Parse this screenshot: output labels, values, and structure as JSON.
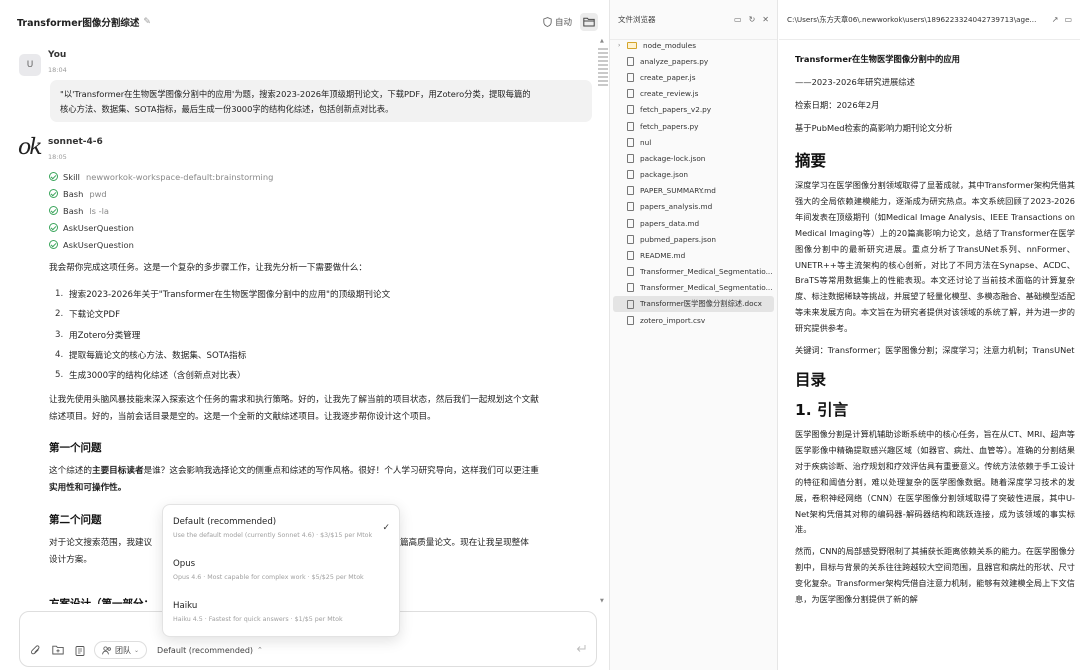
{
  "chat": {
    "title": "Transformer图像分割综述",
    "auto_label": "自动",
    "user": {
      "avatar": "U",
      "name": "You",
      "time": "18:04",
      "message_line1": "\"以'Transformer在生物医学图像分割中的应用'为题，搜索2023-2026年顶级期刊论文，下载PDF，用Zotero分类，提取每篇的",
      "message_line2": "核心方法、数据集、SOTA指标，最后生成一份3000字的结构化综述，包括创新点对比表。"
    },
    "assistant": {
      "logo": "ok",
      "name": "sonnet-4-6",
      "time": "18:05",
      "tools": [
        {
          "name": "Skill",
          "arg": "newworkok-workspace-default:brainstorming"
        },
        {
          "name": "Bash",
          "arg": "pwd"
        },
        {
          "name": "Bash",
          "arg": "ls -la"
        },
        {
          "name": "AskUserQuestion",
          "arg": ""
        },
        {
          "name": "AskUserQuestion",
          "arg": ""
        }
      ],
      "intro": "我会帮你完成这项任务。这是一个复杂的多步骤工作，让我先分析一下需要做什么：",
      "steps": [
        "搜索2023-2026年关于\"Transformer在生物医学图像分割中的应用\"的顶级期刊论文",
        "下载论文PDF",
        "用Zotero分类管理",
        "提取每篇论文的核心方法、数据集、SOTA指标",
        "生成3000字的结构化综述（含创新点对比表）"
      ],
      "para2_line1": "让我先使用头脑风暴技能来深入探索这个任务的需求和执行策略。好的，让我先了解当前的项目状态，然后我们一起规划这个文献",
      "para2_line2": "综述项目。好的，当前会话目录是空的。这是一个全新的文献综述项目。让我逐步帮你设计这个项目。",
      "q1_heading": "第一个问题",
      "q1_pre": "这个综述的",
      "q1_bold": "主要目标读者",
      "q1_post": "是谁？这会影响我选择论文的侧重点和综述的写作风格。很好！个人学习研究导向，这样我们可以更注重",
      "q1_line2": "实用性和可操作性。",
      "q2_heading": "第二个问题",
      "q2_line1a": "对于论文搜索范围，我建议",
      "q2_line1b": "以聚焦5-8篇高质量论文。现在让我呈现整体",
      "q2_line2": "设计方案。",
      "partial_heading": "方案设计（第一部分：",
      "partial_tail": "架"
    },
    "input": {
      "team_label": "团队",
      "model_label": "Default (recommended)"
    },
    "model_menu": [
      {
        "name": "Default (recommended)",
        "desc": "Use the default model (currently Sonnet 4.6) · $3/$15 per Mtok",
        "selected": true
      },
      {
        "name": "Opus",
        "desc": "Opus 4.6 · Most capable for complex work · $5/$25 per Mtok",
        "selected": false
      },
      {
        "name": "Haiku",
        "desc": "Haiku 4.5 · Fastest for quick answers · $1/$5 per Mtok",
        "selected": false
      }
    ]
  },
  "explorer": {
    "title": "文件浏览器",
    "items": [
      {
        "label": "node_modules",
        "type": "folder"
      },
      {
        "label": "analyze_papers.py",
        "type": "file"
      },
      {
        "label": "create_paper.js",
        "type": "file"
      },
      {
        "label": "create_review.js",
        "type": "file"
      },
      {
        "label": "fetch_papers_v2.py",
        "type": "file"
      },
      {
        "label": "fetch_papers.py",
        "type": "file"
      },
      {
        "label": "nul",
        "type": "file"
      },
      {
        "label": "package-lock.json",
        "type": "file"
      },
      {
        "label": "package.json",
        "type": "file"
      },
      {
        "label": "PAPER_SUMMARY.md",
        "type": "file"
      },
      {
        "label": "papers_analysis.md",
        "type": "file"
      },
      {
        "label": "papers_data.md",
        "type": "file"
      },
      {
        "label": "pubmed_papers.json",
        "type": "file"
      },
      {
        "label": "README.md",
        "type": "file"
      },
      {
        "label": "Transformer_Medical_Segmentatio...",
        "type": "file"
      },
      {
        "label": "Transformer_Medical_Segmentatio...",
        "type": "file"
      },
      {
        "label": "Transformer医学图像分割综述.docx",
        "type": "file",
        "selected": true
      },
      {
        "label": "zotero_import.csv",
        "type": "file"
      }
    ]
  },
  "doc": {
    "path": "C:\\Users\\东方天章06\\.newworkok\\users\\1896223324042739713\\age...",
    "title": "Transformer在生物医学图像分割中的应用",
    "subtitle": "——2023-2026年研究进展综述",
    "date": "检索日期：2026年2月",
    "basis": "基于PubMed检索的高影响力期刊论文分析",
    "abstract_heading": "摘要",
    "abstract": "深度学习在医学图像分割领域取得了显著成就，其中Transformer架构凭借其强大的全局依赖建模能力，逐渐成为研究热点。本文系统回顾了2023-2026年间发表在顶级期刊（如Medical Image Analysis、IEEE Transactions on Medical Imaging等）上的20篇高影响力论文，总结了Transformer在医学图像分割中的最新研究进展。重点分析了TransUNet系列、nnFormer、UNETR++等主流架构的核心创新，对比了不同方法在Synapse、ACDC、BraTS等常用数据集上的性能表现。本文还讨论了当前技术面临的计算复杂度、标注数据稀缺等挑战，并展望了轻量化模型、多模态融合、基础模型适配等未来发展方向。本文旨在为研究者提供对该领域的系统了解，并为进一步的研究提供参考。",
    "keywords": "关键词：Transformer；医学图像分割；深度学习；注意力机制；TransUNet",
    "toc_heading": "目录",
    "intro_heading": "1. 引言",
    "intro_p1": "医学图像分割是计算机辅助诊断系统中的核心任务，旨在从CT、MRI、超声等医学影像中精确提取感兴趣区域（如器官、病灶、血管等）。准确的分割结果对于疾病诊断、治疗规划和疗效评估具有重要意义。传统方法依赖于手工设计的特征和阈值分割，难以处理复杂的医学图像数据。随着深度学习技术的发展，卷积神经网络（CNN）在医学图像分割领域取得了突破性进展，其中U-Net架构凭借其对称的编码器-解码器结构和跳跃连接，成为该领域的事实标准。",
    "intro_p2": "然而，CNN的局部感受野限制了其捕获长距离依赖关系的能力。在医学图像分割中，目标与背景的关系往往跨越较大空间范围，且器官和病灶的形状、尺寸变化复杂。Transformer架构凭借自注意力机制，能够有效建模全局上下文信息，为医学图像分割提供了新的解"
  }
}
